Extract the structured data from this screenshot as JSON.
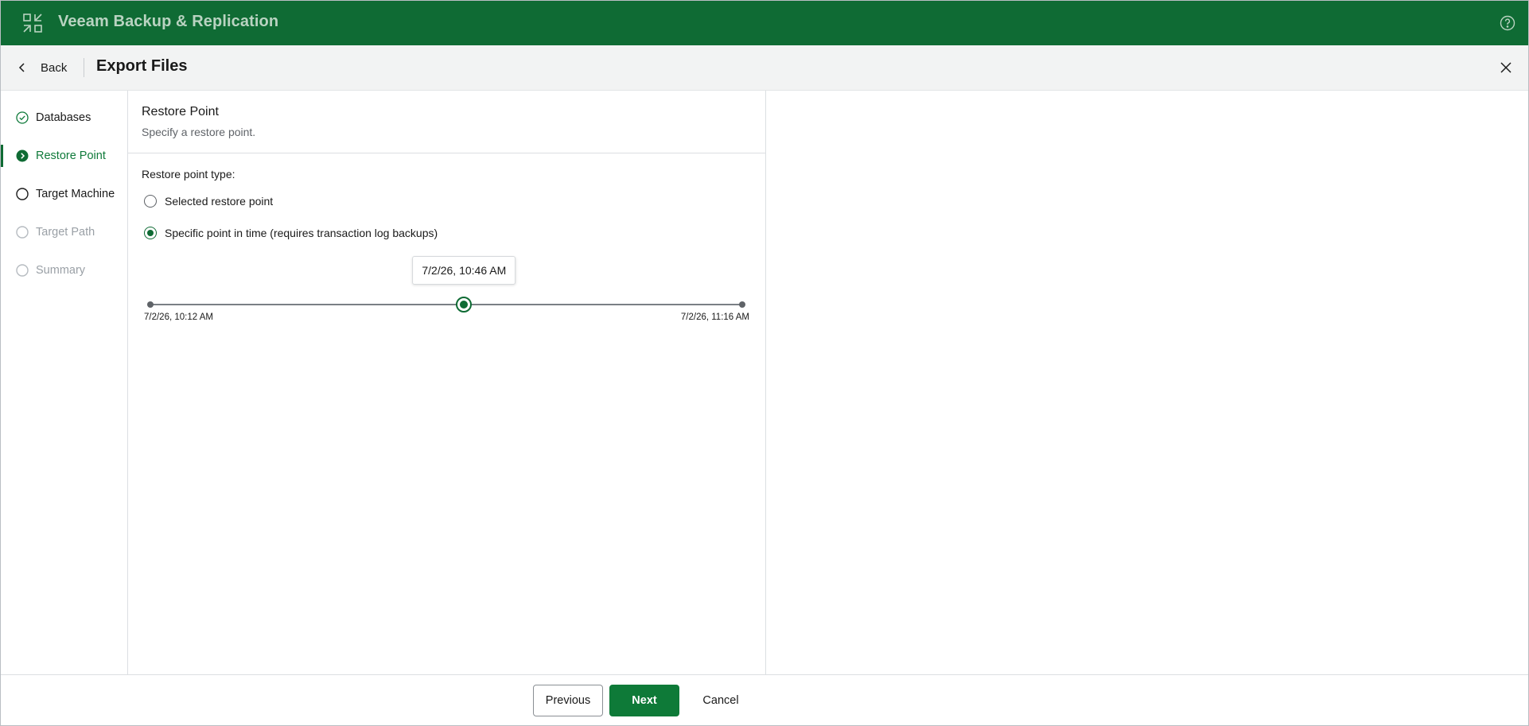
{
  "app": {
    "title": "Veeam Backup & Replication",
    "brand_color": "#0f6b34"
  },
  "header": {
    "back_label": "Back",
    "page_title": "Export Files"
  },
  "steps": [
    {
      "label": "Databases",
      "state": "done"
    },
    {
      "label": "Restore Point",
      "state": "active"
    },
    {
      "label": "Target Machine",
      "state": "todo"
    },
    {
      "label": "Target Path",
      "state": "disabled"
    },
    {
      "label": "Summary",
      "state": "disabled"
    }
  ],
  "main": {
    "section_title": "Restore Point",
    "section_subtitle": "Specify a restore point.",
    "restore_type_label": "Restore point type:",
    "options": [
      {
        "label": "Selected restore point",
        "checked": false
      },
      {
        "label": "Specific point in time (requires transaction log backups)",
        "checked": true
      }
    ],
    "slider": {
      "min_label": "7/2/26, 10:12 AM",
      "max_label": "7/2/26, 11:16 AM",
      "value_label": "7/2/26, 10:46 AM",
      "value_fraction": 0.53
    }
  },
  "footer": {
    "previous_label": "Previous",
    "next_label": "Next",
    "cancel_label": "Cancel"
  }
}
